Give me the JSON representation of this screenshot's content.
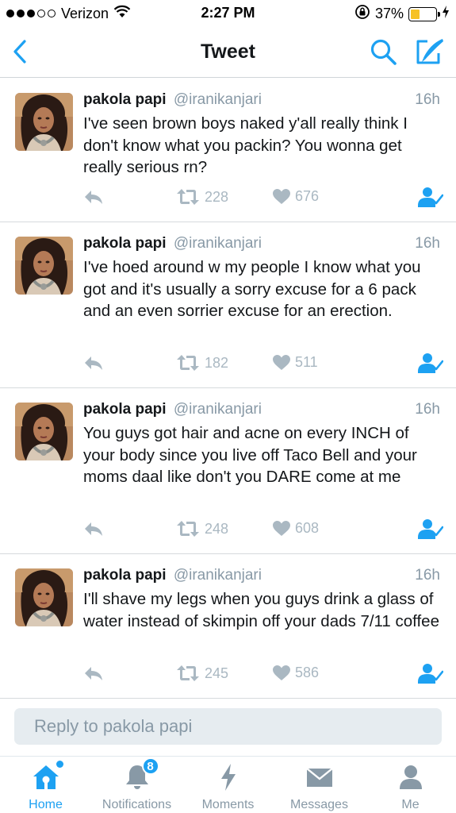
{
  "status_bar": {
    "carrier": "Verizon",
    "time": "2:27 PM",
    "battery": "37%",
    "battery_level": 0.37,
    "signal_bars": 3,
    "signal_total": 5
  },
  "nav": {
    "title": "Tweet",
    "back_icon": "chevron-left-icon",
    "search_icon": "search-icon",
    "compose_icon": "compose-icon"
  },
  "tweets": [
    {
      "name": "pakola papi",
      "handle": "@iranikanjari",
      "time": "16h",
      "text": "I've seen brown boys naked y'all really think I don't know what you packin? You wonna get really serious rn?",
      "retweets": "228",
      "likes": "676"
    },
    {
      "name": "pakola papi",
      "handle": "@iranikanjari",
      "time": "16h",
      "text": "I've hoed around w my people I know what you got and it's usually a sorry excuse for a 6 pack and an even sorrier excuse for an erection.",
      "retweets": "182",
      "likes": "511"
    },
    {
      "name": "pakola papi",
      "handle": "@iranikanjari",
      "time": "16h",
      "text": "You guys got hair and acne on every INCH of your body since you live off Taco Bell and your moms daal like don't you DARE come at me",
      "retweets": "248",
      "likes": "608"
    },
    {
      "name": "pakola papi",
      "handle": "@iranikanjari",
      "time": "16h",
      "text": "I'll shave my legs when you guys drink a glass of water instead of skimpin off your dads 7/11 coffee",
      "retweets": "245",
      "likes": "586"
    }
  ],
  "reply": {
    "placeholder": "Reply to pakola papi"
  },
  "tabs": [
    {
      "label": "Home",
      "icon": "home-icon",
      "active": true
    },
    {
      "label": "Notifications",
      "icon": "bell-icon",
      "badge": "8"
    },
    {
      "label": "Moments",
      "icon": "lightning-icon"
    },
    {
      "label": "Messages",
      "icon": "envelope-icon"
    },
    {
      "label": "Me",
      "icon": "person-icon"
    }
  ],
  "colors": {
    "accent": "#1da1f2",
    "muted": "#8899a6",
    "action_gray": "#aab8c2",
    "battery": "#f6c225"
  }
}
